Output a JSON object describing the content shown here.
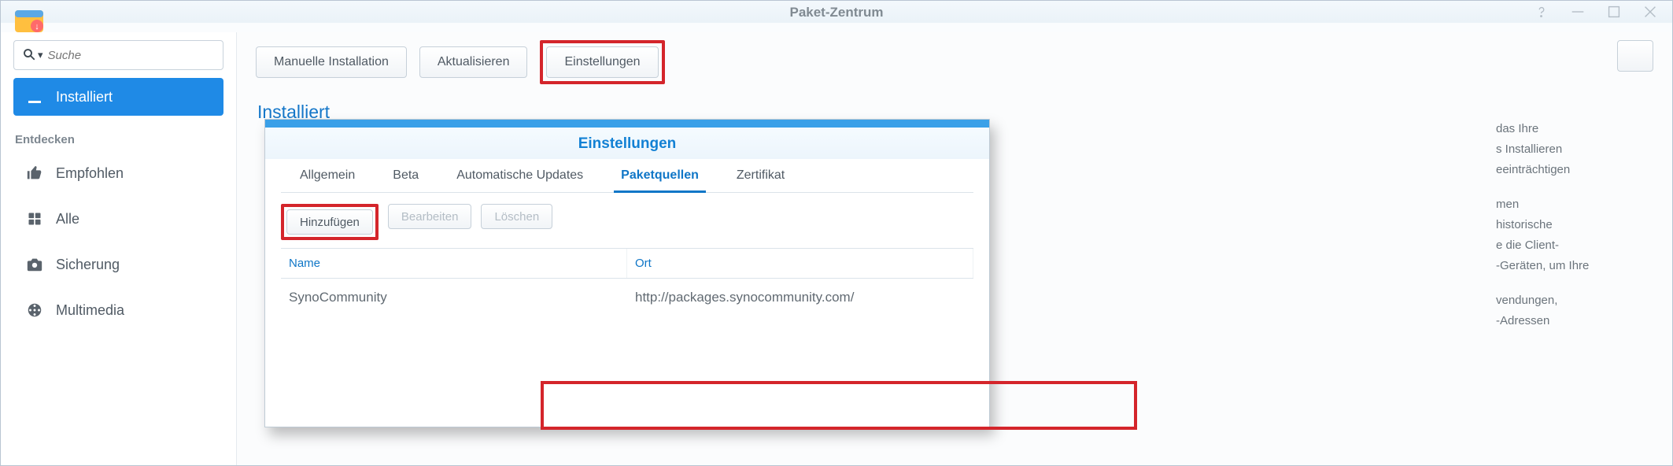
{
  "window": {
    "title": "Paket-Zentrum"
  },
  "search": {
    "placeholder": "Suche"
  },
  "sidebar": {
    "installed_label": "Installiert",
    "discover_title": "Entdecken",
    "items": [
      {
        "label": "Empfohlen"
      },
      {
        "label": "Alle"
      },
      {
        "label": "Sicherung"
      },
      {
        "label": "Multimedia"
      }
    ]
  },
  "toolbar": {
    "manual_install": "Manuelle Installation",
    "refresh": "Aktualisieren",
    "settings": "Einstellungen"
  },
  "page": {
    "title": "Installiert"
  },
  "background_text": [
    "das Ihre",
    "s Installieren",
    "eeinträchtigen",
    "",
    "men",
    "historische",
    "e die Client-",
    "-Geräten, um Ihre",
    "",
    "vendungen,",
    "-Adressen"
  ],
  "modal": {
    "title": "Einstellungen",
    "tabs": {
      "general": "Allgemein",
      "beta": "Beta",
      "auto_updates": "Automatische Updates",
      "sources": "Paketquellen",
      "certificate": "Zertifikat"
    },
    "toolbar": {
      "add": "Hinzufügen",
      "edit": "Bearbeiten",
      "delete": "Löschen"
    },
    "columns": {
      "name": "Name",
      "location": "Ort"
    },
    "rows": [
      {
        "name": "SynoCommunity",
        "location": "http://packages.synocommunity.com/"
      }
    ]
  }
}
